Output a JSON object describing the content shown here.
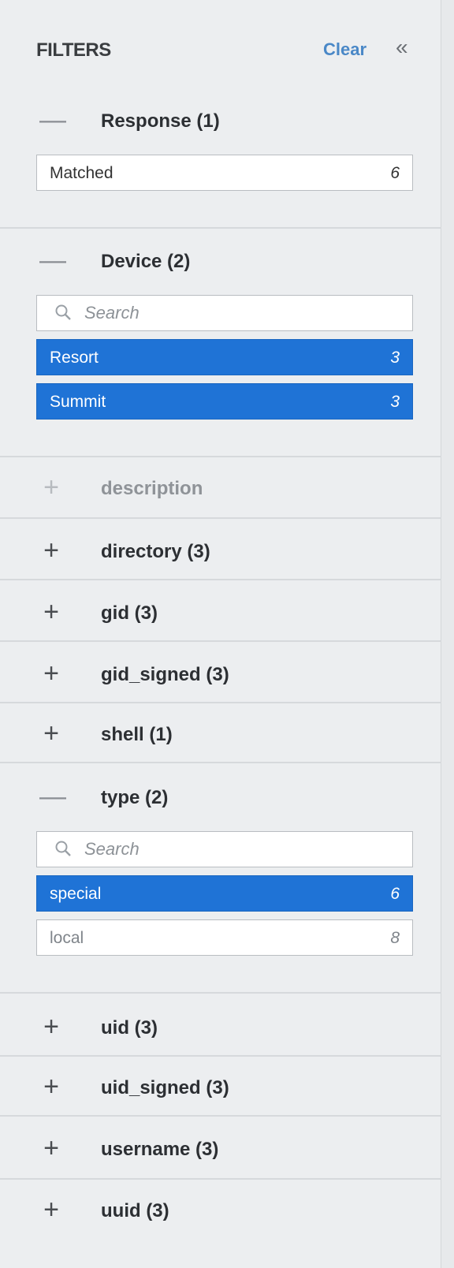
{
  "header": {
    "title": "FILTERS",
    "clear_label": "Clear",
    "collapse_glyph": "«"
  },
  "sections": {
    "response": {
      "label": "Response (1)",
      "state": "expanded",
      "items": [
        {
          "name": "Matched",
          "count": "6",
          "selected": false
        }
      ]
    },
    "device": {
      "label": "Device (2)",
      "state": "expanded",
      "search_placeholder": "Search",
      "items": [
        {
          "name": "Resort",
          "count": "3",
          "selected": true
        },
        {
          "name": "Summit",
          "count": "3",
          "selected": true
        }
      ]
    },
    "description": {
      "label": "description",
      "state": "collapsed-disabled"
    },
    "directory": {
      "label": "directory (3)",
      "state": "collapsed"
    },
    "gid": {
      "label": "gid (3)",
      "state": "collapsed"
    },
    "gid_signed": {
      "label": "gid_signed (3)",
      "state": "collapsed"
    },
    "shell": {
      "label": "shell (1)",
      "state": "collapsed"
    },
    "type": {
      "label": "type (2)",
      "state": "expanded",
      "search_placeholder": "Search",
      "items": [
        {
          "name": "special",
          "count": "6",
          "selected": true
        },
        {
          "name": "local",
          "count": "8",
          "selected": false
        }
      ]
    },
    "uid": {
      "label": "uid (3)",
      "state": "collapsed"
    },
    "uid_signed": {
      "label": "uid_signed (3)",
      "state": "collapsed"
    },
    "username": {
      "label": "username (3)",
      "state": "collapsed"
    },
    "uuid": {
      "label": "uuid (3)",
      "state": "collapsed"
    }
  },
  "symbols": {
    "expanded": "—",
    "collapsed": "+"
  },
  "colors": {
    "panel_bg": "#eceef0",
    "selected_bg": "#1f73d6",
    "clear_link": "#4a88c7",
    "divider": "#d6d9dc"
  }
}
